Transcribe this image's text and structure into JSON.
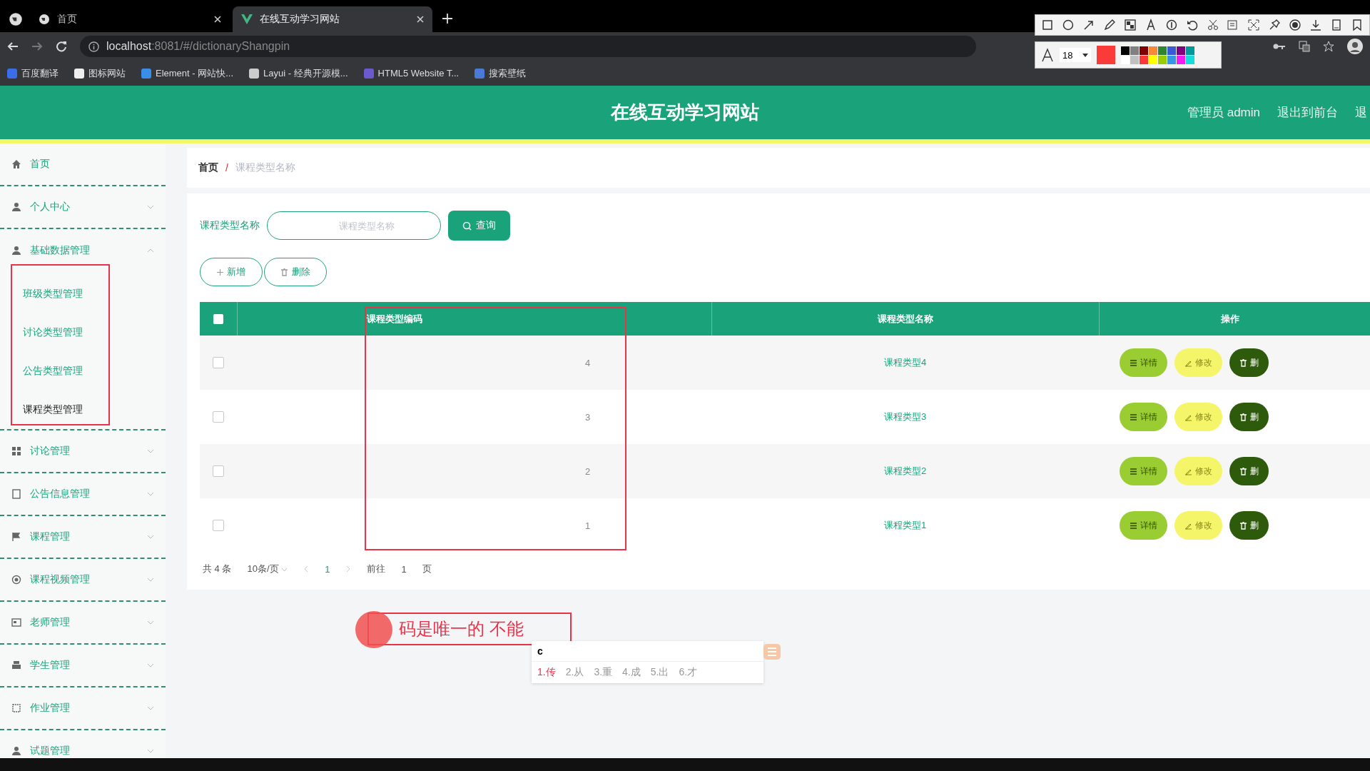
{
  "browser": {
    "tabs": [
      {
        "title": "首页",
        "selected": false
      },
      {
        "title": "在线互动学习网站",
        "selected": true
      }
    ],
    "url_host": "localhost",
    "url_rest": ":8081/#/dictionaryShangpin",
    "bookmarks": [
      "百度翻译",
      "图标网站",
      "Element - 网站快...",
      "Layui - 经典开源模...",
      "HTML5 Website T...",
      "搜索壁纸"
    ]
  },
  "capture_tool": {
    "font_size": "18",
    "current_swatch": {
      "color": "#fb3a3a"
    },
    "palette": [
      {
        "color": "#000000"
      },
      {
        "color": "#808080"
      },
      {
        "color": "#800000"
      },
      {
        "color": "#f7883a"
      },
      {
        "color": "#308430"
      },
      {
        "color": "#385ad3"
      },
      {
        "color": "#800080"
      },
      {
        "color": "#009999"
      },
      {
        "color": "#ffffff"
      },
      {
        "color": "#c0c0c0"
      },
      {
        "color": "#fb3838"
      },
      {
        "color": "#ffff00"
      },
      {
        "color": "#99cc00"
      },
      {
        "color": "#3894e4"
      },
      {
        "color": "#f31bf3"
      },
      {
        "color": "#16dcdc"
      }
    ]
  },
  "header": {
    "title": "在线互动学习网站",
    "user": "管理员 admin",
    "links": [
      "退出到前台",
      "退"
    ]
  },
  "sidebar": {
    "items": [
      {
        "label": "首页",
        "kind": "link"
      },
      {
        "label": "个人中心",
        "kind": "menu",
        "expanded": false
      },
      {
        "label": "基础数据管理",
        "kind": "menu",
        "expanded": true,
        "children": [
          {
            "label": "班级类型管理",
            "selected": false
          },
          {
            "label": "讨论类型管理",
            "selected": false
          },
          {
            "label": "公告类型管理",
            "selected": false
          },
          {
            "label": "课程类型管理",
            "selected": true
          }
        ]
      },
      {
        "label": "讨论管理",
        "kind": "menu",
        "expanded": false
      },
      {
        "label": "公告信息管理",
        "kind": "menu",
        "expanded": false
      },
      {
        "label": "课程管理",
        "kind": "menu",
        "expanded": false
      },
      {
        "label": "课程视频管理",
        "kind": "menu",
        "expanded": false
      },
      {
        "label": "老师管理",
        "kind": "menu",
        "expanded": false
      },
      {
        "label": "学生管理",
        "kind": "menu",
        "expanded": false
      },
      {
        "label": "作业管理",
        "kind": "menu",
        "expanded": false
      },
      {
        "label": "试题管理",
        "kind": "menu",
        "expanded": false
      }
    ]
  },
  "breadcrumb": {
    "home": "首页",
    "separator": "/",
    "current": "课程类型名称"
  },
  "search": {
    "label": "课程类型名称",
    "placeholder": "课程类型名称",
    "button": "查询"
  },
  "actions": [
    "新增",
    "删除"
  ],
  "table": {
    "select_all": false,
    "columns": [
      "课程类型编码",
      "课程类型名称",
      "操作"
    ],
    "rows": [
      {
        "code": "4",
        "name": "课程类型4",
        "selected": false,
        "buttons": [
          "详情",
          "修改",
          "删"
        ]
      },
      {
        "code": "3",
        "name": "课程类型3",
        "selected": false,
        "buttons": [
          "详情",
          "修改",
          "删"
        ]
      },
      {
        "code": "2",
        "name": "课程类型2",
        "selected": false,
        "buttons": [
          "详情",
          "修改",
          "删"
        ]
      },
      {
        "code": "1",
        "name": "课程类型1",
        "selected": false,
        "buttons": [
          "详情",
          "修改",
          "删"
        ]
      }
    ]
  },
  "pagination": {
    "total": "共 4 条",
    "page_size": "10条/页",
    "current": "1",
    "goto": "前往",
    "page": "1",
    "suffix": "页"
  },
  "annotation": {
    "text": "码是唯一的  不能",
    "ime_input": "c",
    "candidates": [
      "1.传",
      "2.从",
      "3.重",
      "4.成",
      "5.出",
      "6.才"
    ]
  }
}
